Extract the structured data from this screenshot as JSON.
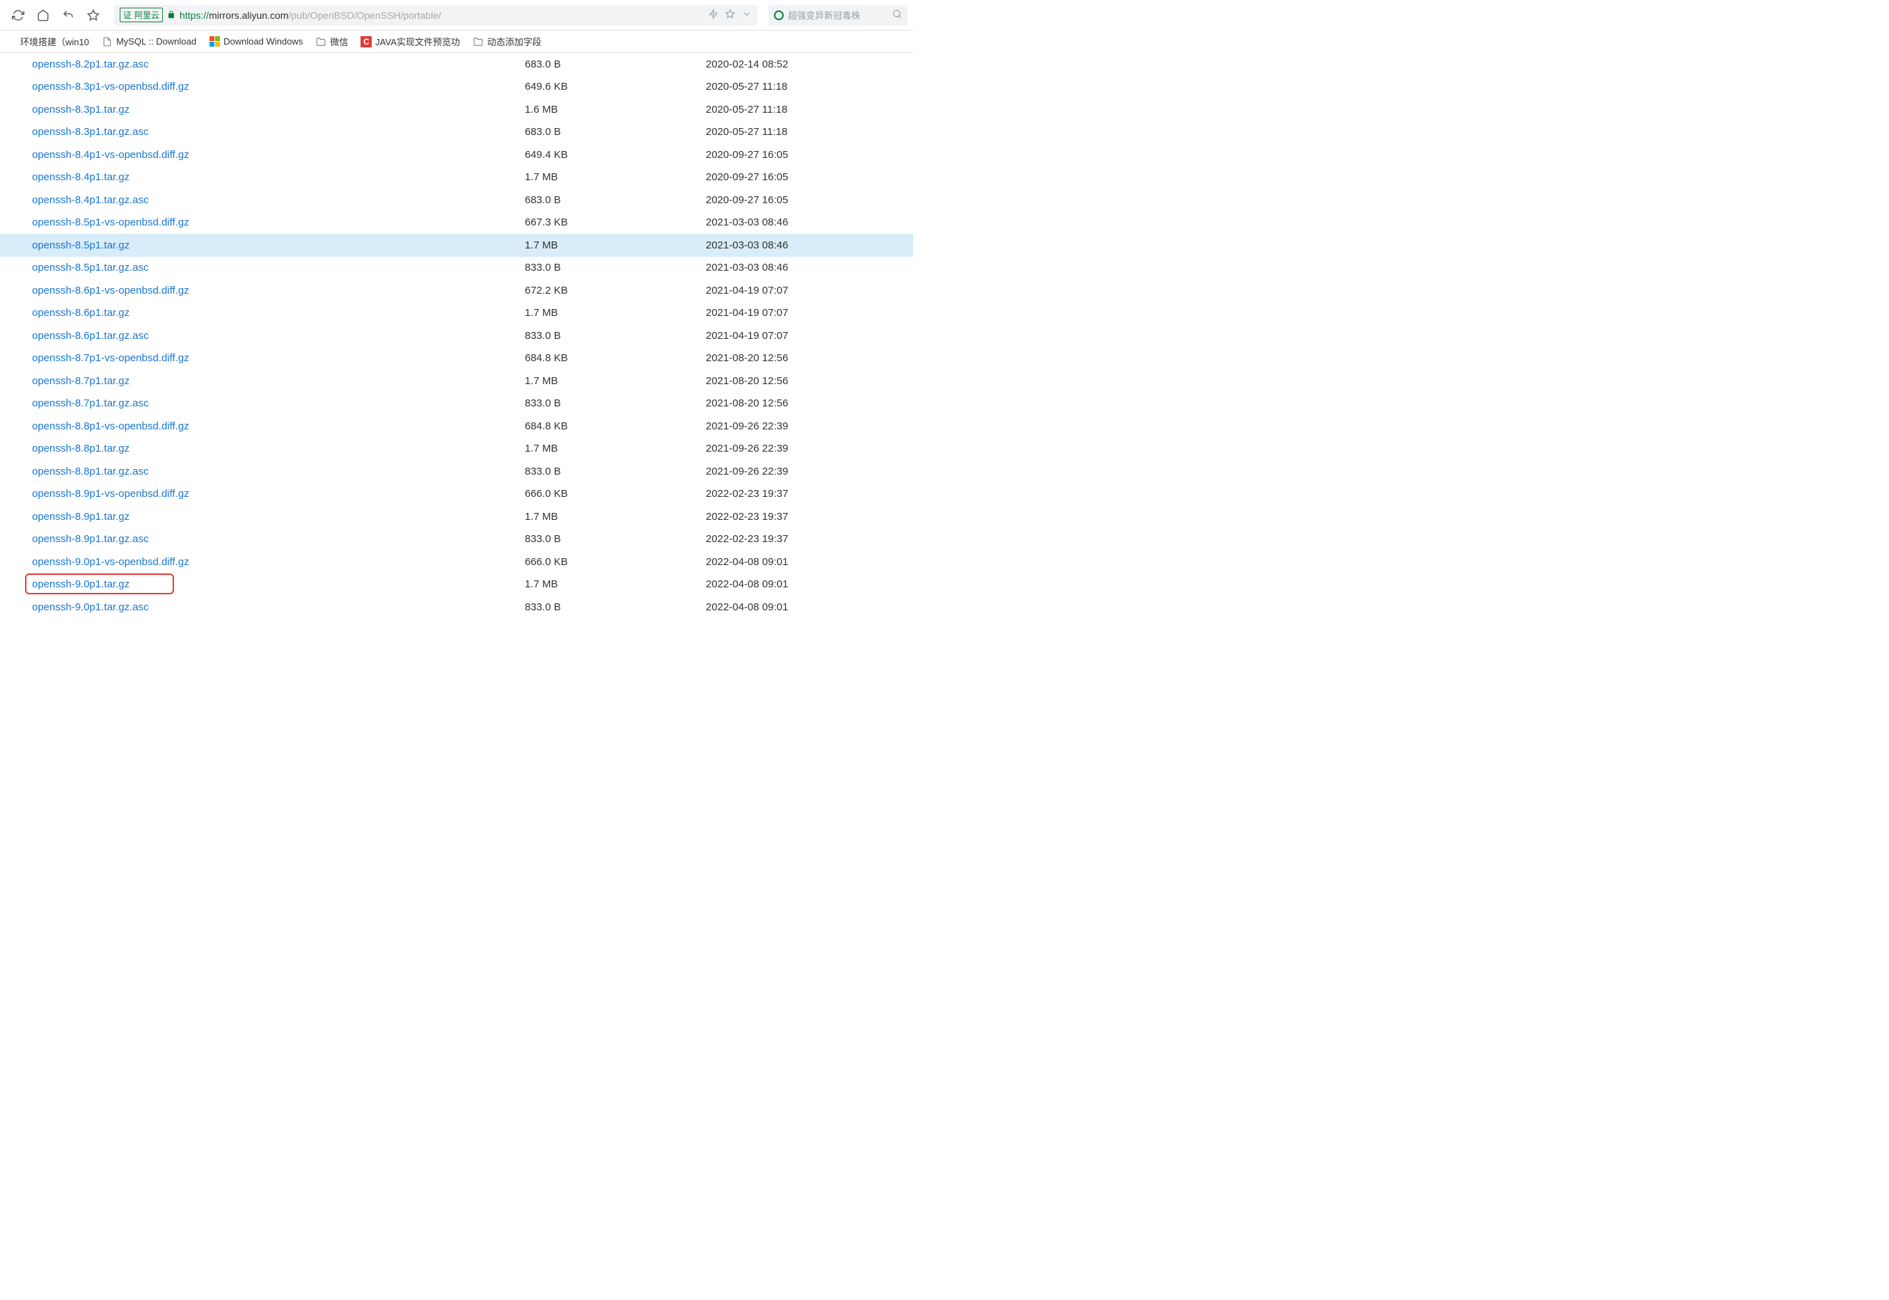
{
  "url": {
    "cert_label": "阿里云",
    "scheme": "https://",
    "host": "mirrors.aliyun.com",
    "path": "/pub/OpenBSD/OpenSSH/portable/"
  },
  "search": {
    "placeholder": "超强变异新冠毒株"
  },
  "bookmarks": [
    {
      "label": "环境搭建（win10",
      "icon": "none"
    },
    {
      "label": "MySQL :: Download",
      "icon": "page"
    },
    {
      "label": "Download Windows",
      "icon": "ms"
    },
    {
      "label": "微信",
      "icon": "folder"
    },
    {
      "label": "JAVA实现文件预览功",
      "icon": "c"
    },
    {
      "label": "动态添加字段",
      "icon": "folder"
    }
  ],
  "files": [
    {
      "name": "openssh-8.2p1.tar.gz.asc",
      "size": "683.0 B",
      "date": "2020-02-14 08:52"
    },
    {
      "name": "openssh-8.3p1-vs-openbsd.diff.gz",
      "size": "649.6 KB",
      "date": "2020-05-27 11:18"
    },
    {
      "name": "openssh-8.3p1.tar.gz",
      "size": "1.6 MB",
      "date": "2020-05-27 11:18"
    },
    {
      "name": "openssh-8.3p1.tar.gz.asc",
      "size": "683.0 B",
      "date": "2020-05-27 11:18"
    },
    {
      "name": "openssh-8.4p1-vs-openbsd.diff.gz",
      "size": "649.4 KB",
      "date": "2020-09-27 16:05"
    },
    {
      "name": "openssh-8.4p1.tar.gz",
      "size": "1.7 MB",
      "date": "2020-09-27 16:05"
    },
    {
      "name": "openssh-8.4p1.tar.gz.asc",
      "size": "683.0 B",
      "date": "2020-09-27 16:05"
    },
    {
      "name": "openssh-8.5p1-vs-openbsd.diff.gz",
      "size": "667.3 KB",
      "date": "2021-03-03 08:46"
    },
    {
      "name": "openssh-8.5p1.tar.gz",
      "size": "1.7 MB",
      "date": "2021-03-03 08:46",
      "hover": true
    },
    {
      "name": "openssh-8.5p1.tar.gz.asc",
      "size": "833.0 B",
      "date": "2021-03-03 08:46"
    },
    {
      "name": "openssh-8.6p1-vs-openbsd.diff.gz",
      "size": "672.2 KB",
      "date": "2021-04-19 07:07"
    },
    {
      "name": "openssh-8.6p1.tar.gz",
      "size": "1.7 MB",
      "date": "2021-04-19 07:07"
    },
    {
      "name": "openssh-8.6p1.tar.gz.asc",
      "size": "833.0 B",
      "date": "2021-04-19 07:07"
    },
    {
      "name": "openssh-8.7p1-vs-openbsd.diff.gz",
      "size": "684.8 KB",
      "date": "2021-08-20 12:56"
    },
    {
      "name": "openssh-8.7p1.tar.gz",
      "size": "1.7 MB",
      "date": "2021-08-20 12:56"
    },
    {
      "name": "openssh-8.7p1.tar.gz.asc",
      "size": "833.0 B",
      "date": "2021-08-20 12:56"
    },
    {
      "name": "openssh-8.8p1-vs-openbsd.diff.gz",
      "size": "684.8 KB",
      "date": "2021-09-26 22:39"
    },
    {
      "name": "openssh-8.8p1.tar.gz",
      "size": "1.7 MB",
      "date": "2021-09-26 22:39"
    },
    {
      "name": "openssh-8.8p1.tar.gz.asc",
      "size": "833.0 B",
      "date": "2021-09-26 22:39"
    },
    {
      "name": "openssh-8.9p1-vs-openbsd.diff.gz",
      "size": "666.0 KB",
      "date": "2022-02-23 19:37"
    },
    {
      "name": "openssh-8.9p1.tar.gz",
      "size": "1.7 MB",
      "date": "2022-02-23 19:37"
    },
    {
      "name": "openssh-8.9p1.tar.gz.asc",
      "size": "833.0 B",
      "date": "2022-02-23 19:37"
    },
    {
      "name": "openssh-9.0p1-vs-openbsd.diff.gz",
      "size": "666.0 KB",
      "date": "2022-04-08 09:01"
    },
    {
      "name": "openssh-9.0p1.tar.gz",
      "size": "1.7 MB",
      "date": "2022-04-08 09:01",
      "boxed": true
    },
    {
      "name": "openssh-9.0p1.tar.gz.asc",
      "size": "833.0 B",
      "date": "2022-04-08 09:01"
    }
  ]
}
